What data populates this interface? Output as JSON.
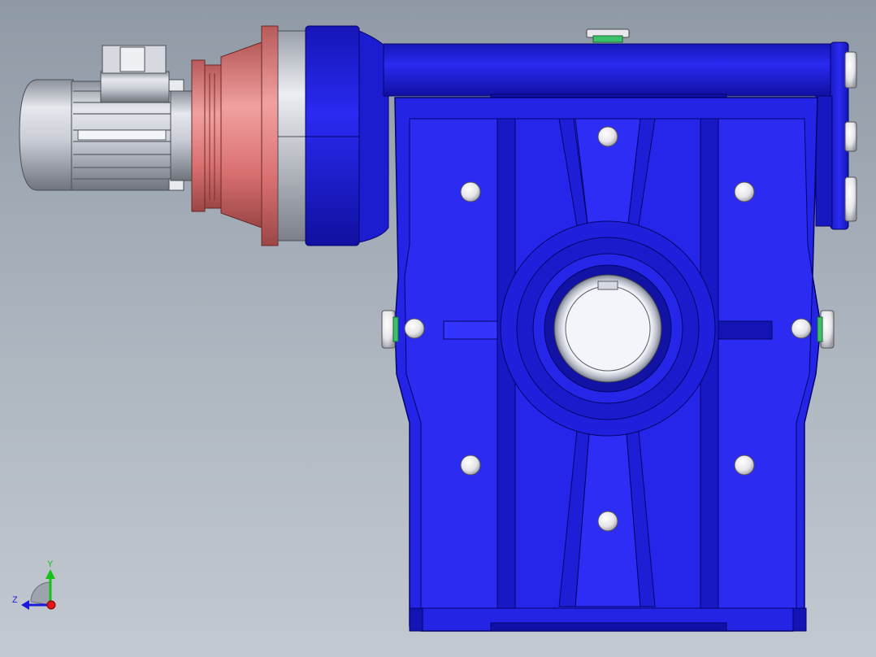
{
  "viewport": {
    "background_top": "#8f9aa6",
    "background_bottom": "#c3c9d0"
  },
  "colors": {
    "housing_blue": "#2323e0",
    "housing_blue_dark": "#0c0c9a",
    "housing_blue_light": "#4747ff",
    "motor_silver": "#c8ccd4",
    "adapter_red": "#d97070",
    "bolt_white": "#f2f2f2"
  },
  "triad": {
    "y_label": "Y",
    "z_label": "Z",
    "y_color": "#18c018",
    "z_color": "#1a1ad8",
    "x_color": "#e01818"
  }
}
